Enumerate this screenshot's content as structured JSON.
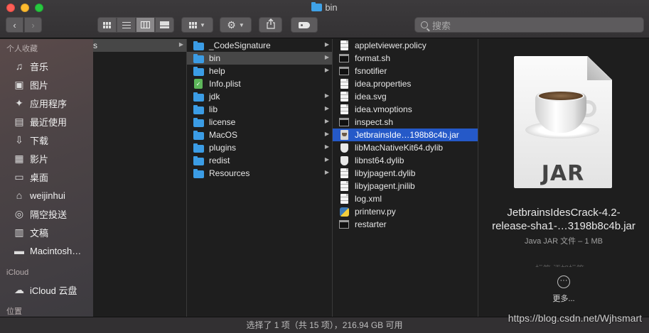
{
  "window": {
    "title": "bin"
  },
  "toolbar": {
    "back_icon": "chevron-left-icon",
    "forward_icon": "chevron-right-icon",
    "view_modes": [
      "icon-view",
      "list-view",
      "column-view",
      "gallery-view"
    ],
    "active_view": "column-view",
    "search_placeholder": "搜索"
  },
  "sidebar": {
    "favorites_heading": "个人收藏",
    "favorites": [
      {
        "label": "音乐",
        "icon": "music-icon"
      },
      {
        "label": "图片",
        "icon": "camera-icon"
      },
      {
        "label": "应用程序",
        "icon": "applications-icon"
      },
      {
        "label": "最近使用",
        "icon": "recents-icon"
      },
      {
        "label": "下载",
        "icon": "download-icon"
      },
      {
        "label": "影片",
        "icon": "movie-icon"
      },
      {
        "label": "桌面",
        "icon": "desktop-icon"
      },
      {
        "label": "weijinhui",
        "icon": "home-icon"
      },
      {
        "label": "隔空投送",
        "icon": "airdrop-icon"
      },
      {
        "label": "文稿",
        "icon": "documents-icon"
      },
      {
        "label": "Macintosh…",
        "icon": "disk-icon"
      }
    ],
    "icloud_heading": "iCloud",
    "icloud_items": [
      {
        "label": "iCloud 云盘",
        "icon": "cloud-icon"
      }
    ],
    "locations_heading": "位置"
  },
  "column0": {
    "items": [
      {
        "label": "s",
        "has_children": true,
        "selected": "gray"
      }
    ]
  },
  "column1": {
    "items": [
      {
        "label": "_CodeSignature",
        "kind": "folder",
        "has_children": true,
        "selected": "none"
      },
      {
        "label": "bin",
        "kind": "folder",
        "has_children": true,
        "selected": "gray"
      },
      {
        "label": "help",
        "kind": "folder",
        "has_children": true,
        "selected": "none"
      },
      {
        "label": "Info.plist",
        "kind": "plist",
        "has_children": false,
        "selected": "none"
      },
      {
        "label": "jdk",
        "kind": "folder",
        "has_children": true,
        "selected": "none"
      },
      {
        "label": "lib",
        "kind": "folder",
        "has_children": true,
        "selected": "none"
      },
      {
        "label": "license",
        "kind": "folder",
        "has_children": true,
        "selected": "none"
      },
      {
        "label": "MacOS",
        "kind": "folder",
        "has_children": true,
        "selected": "none"
      },
      {
        "label": "plugins",
        "kind": "folder",
        "has_children": true,
        "selected": "none"
      },
      {
        "label": "redist",
        "kind": "folder",
        "has_children": true,
        "selected": "none"
      },
      {
        "label": "Resources",
        "kind": "folder",
        "has_children": true,
        "selected": "none"
      }
    ]
  },
  "column2": {
    "items": [
      {
        "label": "appletviewer.policy",
        "kind": "doc",
        "selected": "none"
      },
      {
        "label": "format.sh",
        "kind": "exec",
        "selected": "none"
      },
      {
        "label": "fsnotifier",
        "kind": "exec",
        "selected": "none"
      },
      {
        "label": "idea.properties",
        "kind": "doc",
        "selected": "none"
      },
      {
        "label": "idea.svg",
        "kind": "doc",
        "selected": "none"
      },
      {
        "label": "idea.vmoptions",
        "kind": "doc",
        "selected": "none"
      },
      {
        "label": "inspect.sh",
        "kind": "exec",
        "selected": "none"
      },
      {
        "label": "JetbrainsIde…198b8c4b.jar",
        "kind": "jar",
        "selected": "blue"
      },
      {
        "label": "libMacNativeKit64.dylib",
        "kind": "shield",
        "selected": "none"
      },
      {
        "label": "libnst64.dylib",
        "kind": "shield",
        "selected": "none"
      },
      {
        "label": "libyjpagent.dylib",
        "kind": "doc",
        "selected": "none"
      },
      {
        "label": "libyjpagent.jnilib",
        "kind": "doc",
        "selected": "none"
      },
      {
        "label": "log.xml",
        "kind": "doc",
        "selected": "none"
      },
      {
        "label": "printenv.py",
        "kind": "python",
        "selected": "none"
      },
      {
        "label": "restarter",
        "kind": "exec",
        "selected": "none"
      }
    ]
  },
  "preview": {
    "icon_label": "JAR",
    "name_line1": "JetbrainsIdesCrack-4.2-",
    "name_line2": "release-sha1-…3198b8c4b.jar",
    "meta": "Java JAR 文件 – 1 MB",
    "tags_text": "标签   添加标签…",
    "more_glyph": "···",
    "more_label": "更多..."
  },
  "statusbar": {
    "text": "选择了 1 项（共 15 项），216.94 GB 可用"
  },
  "watermark": {
    "text": "https://blog.csdn.net/Wjhsmart"
  },
  "colors": {
    "selection_blue": "#2559c8",
    "folder_blue": "#3b9ce5",
    "selection_gray": "#474747"
  }
}
